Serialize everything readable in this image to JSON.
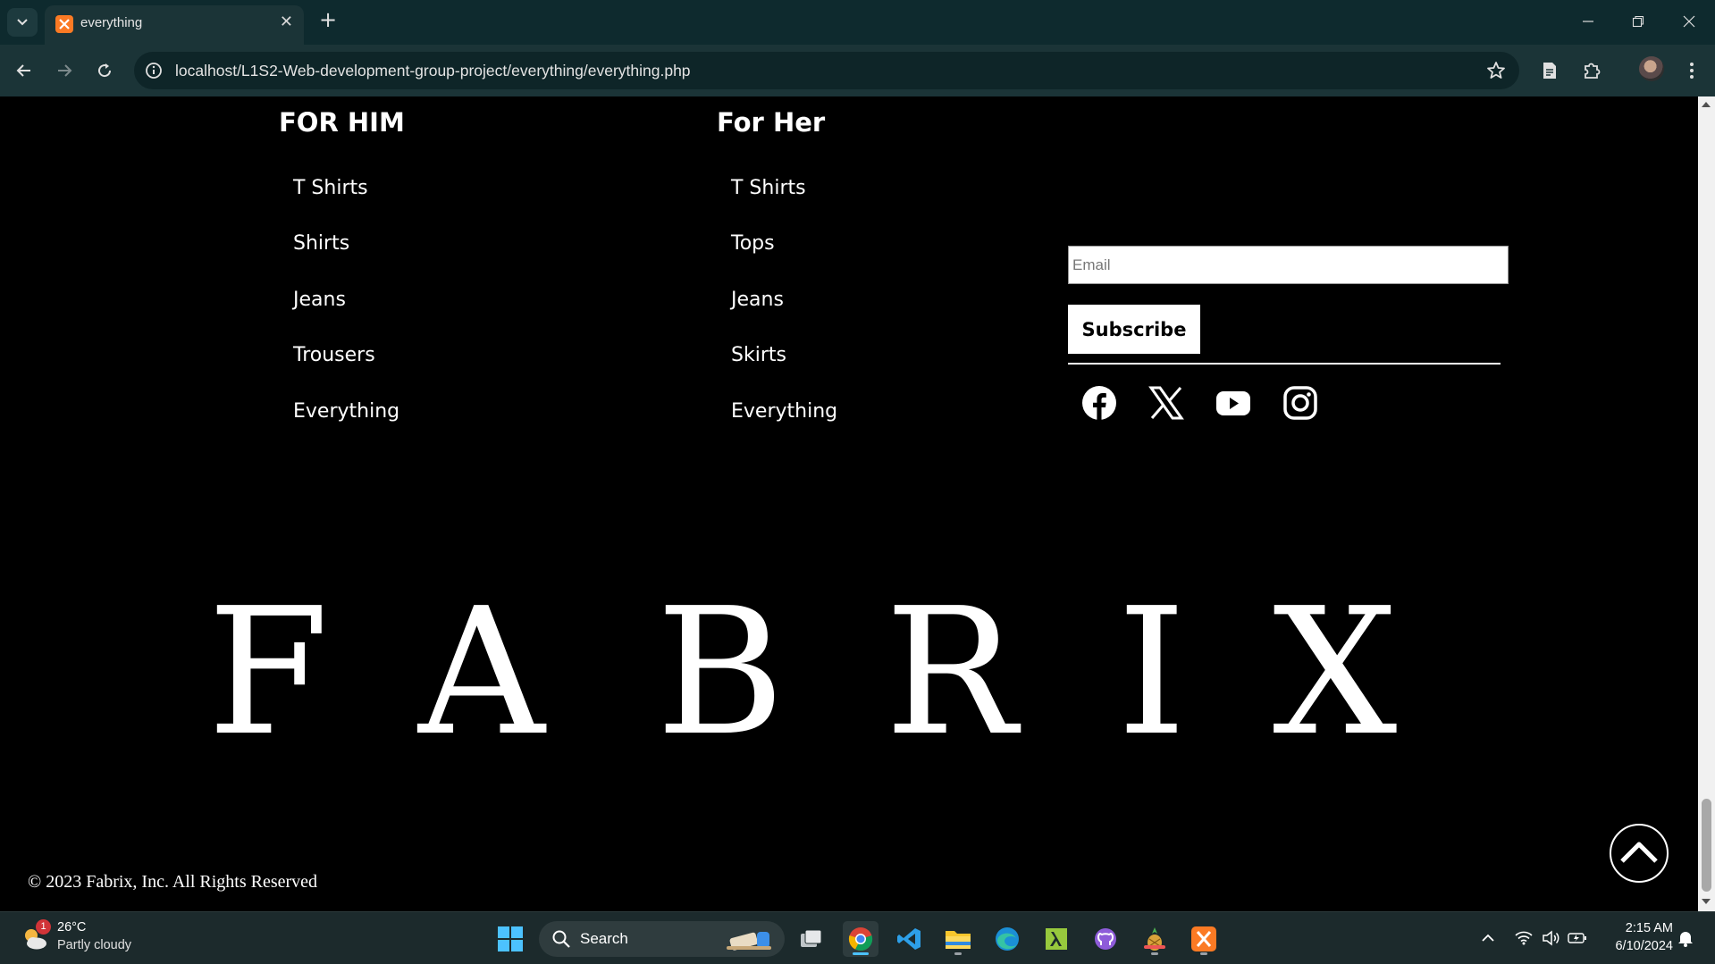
{
  "browser": {
    "tab_title": "everything",
    "url": "localhost/L1S2-Web-development-group-project/everything/everything.php"
  },
  "footer": {
    "for_him": {
      "title": "FOR HIM",
      "links": [
        "T Shirts",
        "Shirts",
        "Jeans",
        "Trousers",
        "Everything"
      ]
    },
    "for_her": {
      "title": "For Her",
      "links": [
        "T Shirts",
        "Tops",
        "Jeans",
        "Skirts",
        "Everything"
      ]
    },
    "newsletter": {
      "email_placeholder": "Email",
      "subscribe_label": "Subscribe"
    },
    "social_icons": [
      "facebook-icon",
      "x-icon",
      "youtube-icon",
      "instagram-icon"
    ],
    "brand_letters": [
      "F",
      "A",
      "B",
      "R",
      "I",
      "X"
    ],
    "copyright": "© 2023 Fabrix, Inc. All Rights Reserved"
  },
  "taskbar": {
    "weather_badge": "1",
    "weather_temp": "26°C",
    "weather_desc": "Partly cloudy",
    "search_label": "Search",
    "time": "2:15 AM",
    "date": "6/10/2024"
  },
  "colors": {
    "page_background": "#000000",
    "text": "#ffffff",
    "browser_frame": "#0e2a2e",
    "taskbar": "#1c2a2c"
  }
}
